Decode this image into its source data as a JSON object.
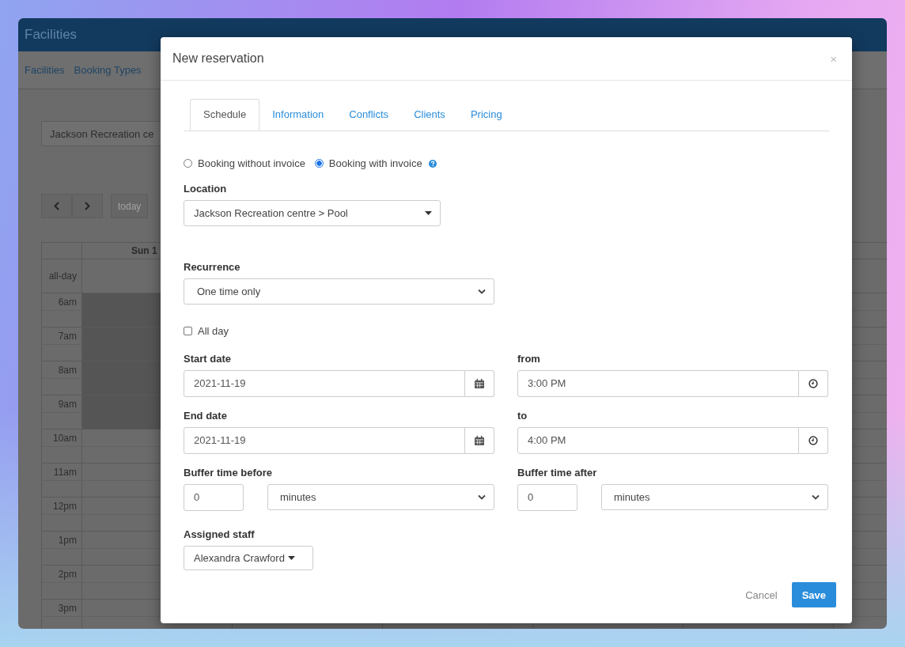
{
  "app": {
    "title": "Facilities",
    "nav": [
      {
        "label": "Facilities"
      },
      {
        "label": "Booking Types"
      }
    ],
    "facility_select": {
      "value": "Jackson Recreation ce"
    },
    "today_button": "today",
    "calendar": {
      "day_header": "Sun 1",
      "all_day_label": "all-day",
      "hours": [
        {
          "label": "6am",
          "shaded": true
        },
        {
          "label": "7am",
          "shaded": true
        },
        {
          "label": "8am",
          "shaded": true
        },
        {
          "label": "9am",
          "shaded": true
        },
        {
          "label": "10am",
          "shaded": false
        },
        {
          "label": "11am",
          "shaded": false
        },
        {
          "label": "12pm",
          "shaded": false
        },
        {
          "label": "1pm",
          "shaded": false
        },
        {
          "label": "2pm",
          "shaded": false
        },
        {
          "label": "3pm",
          "shaded": false
        }
      ]
    }
  },
  "modal": {
    "title": "New reservation",
    "close": "×",
    "tabs": [
      {
        "label": "Schedule",
        "selected": true
      },
      {
        "label": "Information",
        "selected": false
      },
      {
        "label": "Conflicts",
        "selected": false
      },
      {
        "label": "Clients",
        "selected": false
      },
      {
        "label": "Pricing",
        "selected": false
      }
    ],
    "invoice_options": [
      {
        "label": "Booking without invoice",
        "selected": false
      },
      {
        "label": "Booking with invoice",
        "selected": true
      }
    ],
    "location": {
      "label": "Location",
      "value": "Jackson Recreation centre > Pool"
    },
    "recurrence": {
      "label": "Recurrence",
      "value": "One time only"
    },
    "all_day": {
      "label": "All day",
      "checked": false
    },
    "start_date": {
      "label": "Start date",
      "value": "2021-11-19"
    },
    "from": {
      "label": "from",
      "value": "3:00 PM"
    },
    "end_date": {
      "label": "End date",
      "value": "2021-11-19"
    },
    "to": {
      "label": "to",
      "value": "4:00 PM"
    },
    "buffer_before": {
      "label": "Buffer time before",
      "amount": "0",
      "unit": "minutes"
    },
    "buffer_after": {
      "label": "Buffer time after",
      "amount": "0",
      "unit": "minutes"
    },
    "assigned_staff": {
      "label": "Assigned staff",
      "value": "Alexandra Crawford"
    },
    "buttons": [
      {
        "label": "Cancel",
        "kind": "link"
      },
      {
        "label": "Save",
        "kind": "primary"
      }
    ]
  }
}
